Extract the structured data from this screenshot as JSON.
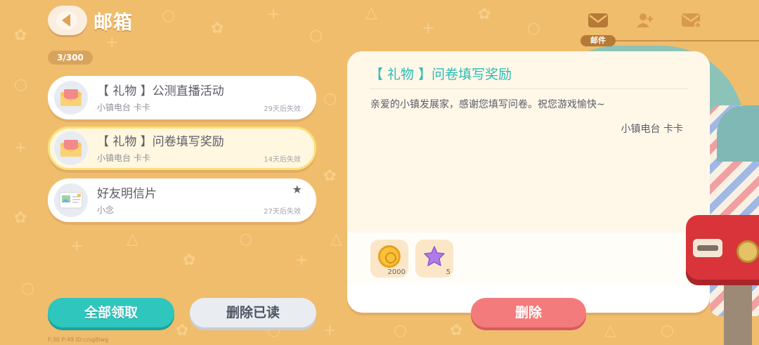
{
  "header": {
    "title": "邮箱",
    "counter": "3/300"
  },
  "tabs": {
    "active_label": "邮件"
  },
  "mails": [
    {
      "subject": "【 礼物 】公测直播活动",
      "sender": "小镇电台 卡卡",
      "expire": "29天后失效"
    },
    {
      "subject": "【 礼物 】问卷填写奖励",
      "sender": "小镇电台 卡卡",
      "expire": "14天后失效"
    },
    {
      "subject": "好友明信片",
      "sender": "小念",
      "expire": "27天后失效"
    }
  ],
  "detail": {
    "title": "【 礼物 】问卷填写奖励",
    "body": "亲爱的小镇发展家，感谢您填写问卷。祝您游戏愉快~",
    "signature": "小镇电台 卡卡",
    "attachments": [
      {
        "icon": "coin-icon",
        "count": "2000"
      },
      {
        "icon": "star-icon",
        "count": "5"
      }
    ]
  },
  "buttons": {
    "claim_all": "全部领取",
    "delete_read": "删除已读",
    "delete": "删除"
  },
  "debug": "F:30 P:49 ID:c/sg8lwg",
  "colors": {
    "accent_teal": "#2fc6be",
    "delete_red": "#f37b7b",
    "background": "#f0bd6c"
  }
}
